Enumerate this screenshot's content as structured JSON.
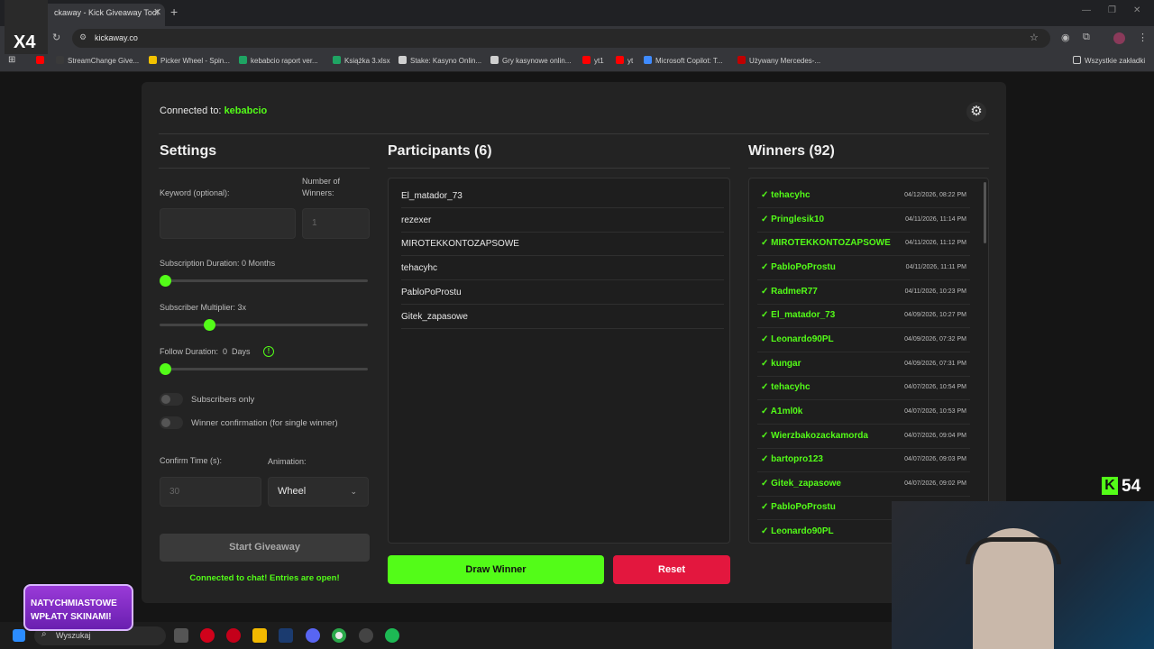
{
  "browser": {
    "tab_title": "ckaway - Kick Giveaway Tool",
    "url": "kickaway.co",
    "bookmarks": [
      {
        "label": "StreamChange Give...",
        "color": "#3a3a3a"
      },
      {
        "label": "Picker Wheel - Spin...",
        "color": "#f2c200"
      },
      {
        "label": "kebabcio raport ver...",
        "color": "#1fa463"
      },
      {
        "label": "Książka 3.xlsx",
        "color": "#1fa463"
      },
      {
        "label": "Stake: Kasyno Onlin...",
        "color": "#cfcfcf"
      },
      {
        "label": "Gry kasynowe onlin...",
        "color": "#cfcfcf"
      },
      {
        "label": "yt1",
        "color": "#ff0000"
      },
      {
        "label": "yt",
        "color": "#ff0000"
      },
      {
        "label": "Microsoft Copilot: T...",
        "color": "#3f8bff"
      },
      {
        "label": "Używany Mercedes-...",
        "color": "#c00000"
      }
    ],
    "all_bookmarks": "Wszystkie zakładki"
  },
  "header": {
    "connected_prefix": "Connected to:",
    "channel": "kebabcio"
  },
  "settings": {
    "title": "Settings",
    "keyword_label": "Keyword (optional):",
    "keyword_value": "",
    "winners_label": "Number of Winners:",
    "winners_placeholder": "1",
    "sub_duration_label": "Subscription Duration: 0 Months",
    "sub_duration_value": 0,
    "sub_multiplier_label": "Subscriber Multiplier: 3x",
    "sub_multiplier_value": 3,
    "follow_label": "Follow Duration:  0  Days",
    "follow_value": 0,
    "subscribers_only": "Subscribers only",
    "winner_confirmation": "Winner confirmation (for single winner)",
    "confirm_label": "Confirm Time (s):",
    "confirm_placeholder": "30",
    "animation_label": "Animation:",
    "animation_value": "Wheel",
    "start_button": "Start Giveaway",
    "status": "Connected to chat! Entries are open!"
  },
  "participants": {
    "title": "Participants (6)",
    "items": [
      "El_matador_73",
      "rezexer",
      "MIROTEKKONTOZAPSOWE",
      "tehacyhc",
      "PabloPoProstu",
      "Gitek_zapasowe"
    ]
  },
  "winners": {
    "title": "Winners (92)",
    "items": [
      {
        "name": "✓ tehacyhc",
        "date": "04/12/2026, 08:22 PM"
      },
      {
        "name": "✓ Pringlesik10",
        "date": "04/11/2026, 11:14 PM"
      },
      {
        "name": "✓ MIROTEKKONTOZAPSOWE",
        "date": "04/11/2026, 11:12 PM"
      },
      {
        "name": "✓ PabloPoProstu",
        "date": "04/11/2026, 11:11 PM"
      },
      {
        "name": "✓ RadmeR77",
        "date": "04/11/2026, 10:23 PM"
      },
      {
        "name": "✓ El_matador_73",
        "date": "04/09/2026, 10:27 PM"
      },
      {
        "name": "✓ Leonardo90PL",
        "date": "04/09/2026, 07:32 PM"
      },
      {
        "name": "✓ kungar",
        "date": "04/09/2026, 07:31 PM"
      },
      {
        "name": "✓ tehacyhc",
        "date": "04/07/2026, 10:54 PM"
      },
      {
        "name": "✓ A1ml0k",
        "date": "04/07/2026, 10:53 PM"
      },
      {
        "name": "✓ Wierzbakozackamorda",
        "date": "04/07/2026, 09:04 PM"
      },
      {
        "name": "✓ bartopro123",
        "date": "04/07/2026, 09:03 PM"
      },
      {
        "name": "✓ Gitek_zapasowe",
        "date": "04/07/2026, 09:02 PM"
      },
      {
        "name": "✓ PabloPoProstu",
        "date": ""
      },
      {
        "name": "✓ Leonardo90PL",
        "date": ""
      }
    ]
  },
  "actions": {
    "draw": "Draw Winner",
    "reset": "Reset"
  },
  "taskbar": {
    "search": "Wyszukaj"
  },
  "overlay": {
    "kick_count": "54",
    "kick_letter": "K",
    "promo_line1": "NATYCHMIASTOWE",
    "promo_line2": "WPŁATY SKINAMI!",
    "multiplier": "X4"
  },
  "colors": {
    "accent": "#53fc18",
    "reset": "#e3173e",
    "card": "#232323",
    "page": "#151515"
  }
}
